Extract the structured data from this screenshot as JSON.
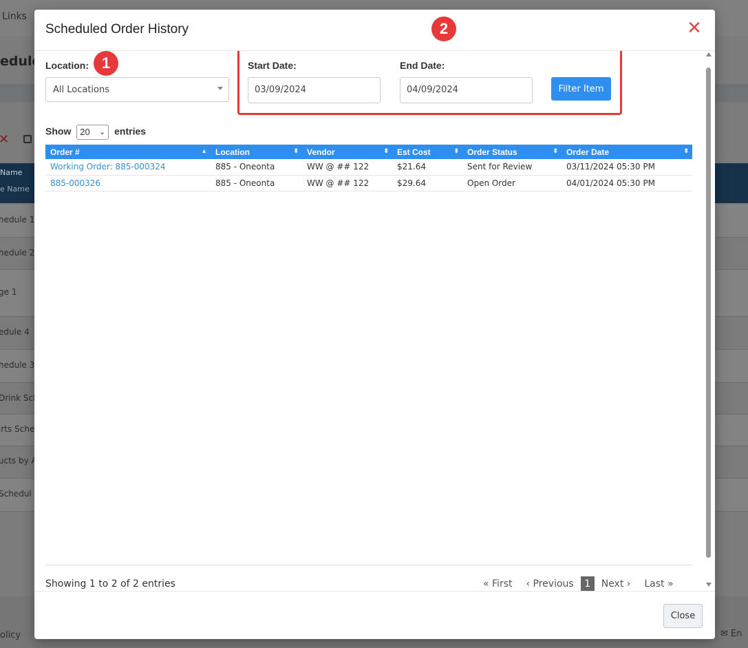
{
  "background": {
    "topbar_text": "Links",
    "page_title": "eduled",
    "toolbar_x": "✕",
    "header_col1": "Name",
    "header_col2": "e Name",
    "rows": [
      "hedule 1",
      "hedule 2",
      "ge 1",
      "edule 4",
      "hedule 3",
      "Drink Sch",
      "irts Sche",
      "ucts by A",
      "Schedul"
    ],
    "footer_left": "olicy",
    "footer_right": "✉ En"
  },
  "modal": {
    "title": "Scheduled Order History",
    "close_glyph": "✕",
    "badge_1": "1",
    "badge_2": "2",
    "location": {
      "label": "Location:",
      "value": "All Locations"
    },
    "start_date": {
      "label": "Start Date:",
      "value": "03/09/2024"
    },
    "end_date": {
      "label": "End Date:",
      "value": "04/09/2024"
    },
    "filter_button": "Filter Item",
    "show": {
      "prefix": "Show",
      "value": "20",
      "suffix": "entries"
    },
    "table": {
      "columns": [
        "Order #",
        "Location",
        "Vendor",
        "Est Cost",
        "Order Status",
        "Order Date"
      ],
      "rows": [
        [
          "Working Order: 885-000324",
          "885 - Oneonta",
          "WW @ ## 122",
          "$21.64",
          "Sent for Review",
          "03/11/2024 05:30 PM"
        ],
        [
          "885-000326",
          "885 - Oneonta",
          "WW @ ## 122",
          "$29.64",
          "Open Order",
          "04/01/2024 05:30 PM"
        ]
      ]
    },
    "info": "Showing 1 to 2 of 2 entries",
    "pager": {
      "first": "« First",
      "previous": "‹ Previous",
      "current": "1",
      "next": "Next ›",
      "last": "Last »"
    },
    "close_button": "Close"
  },
  "colors": {
    "accent": "#2f8ff0",
    "highlight": "#e03a3a",
    "link": "#3a8fd1"
  }
}
